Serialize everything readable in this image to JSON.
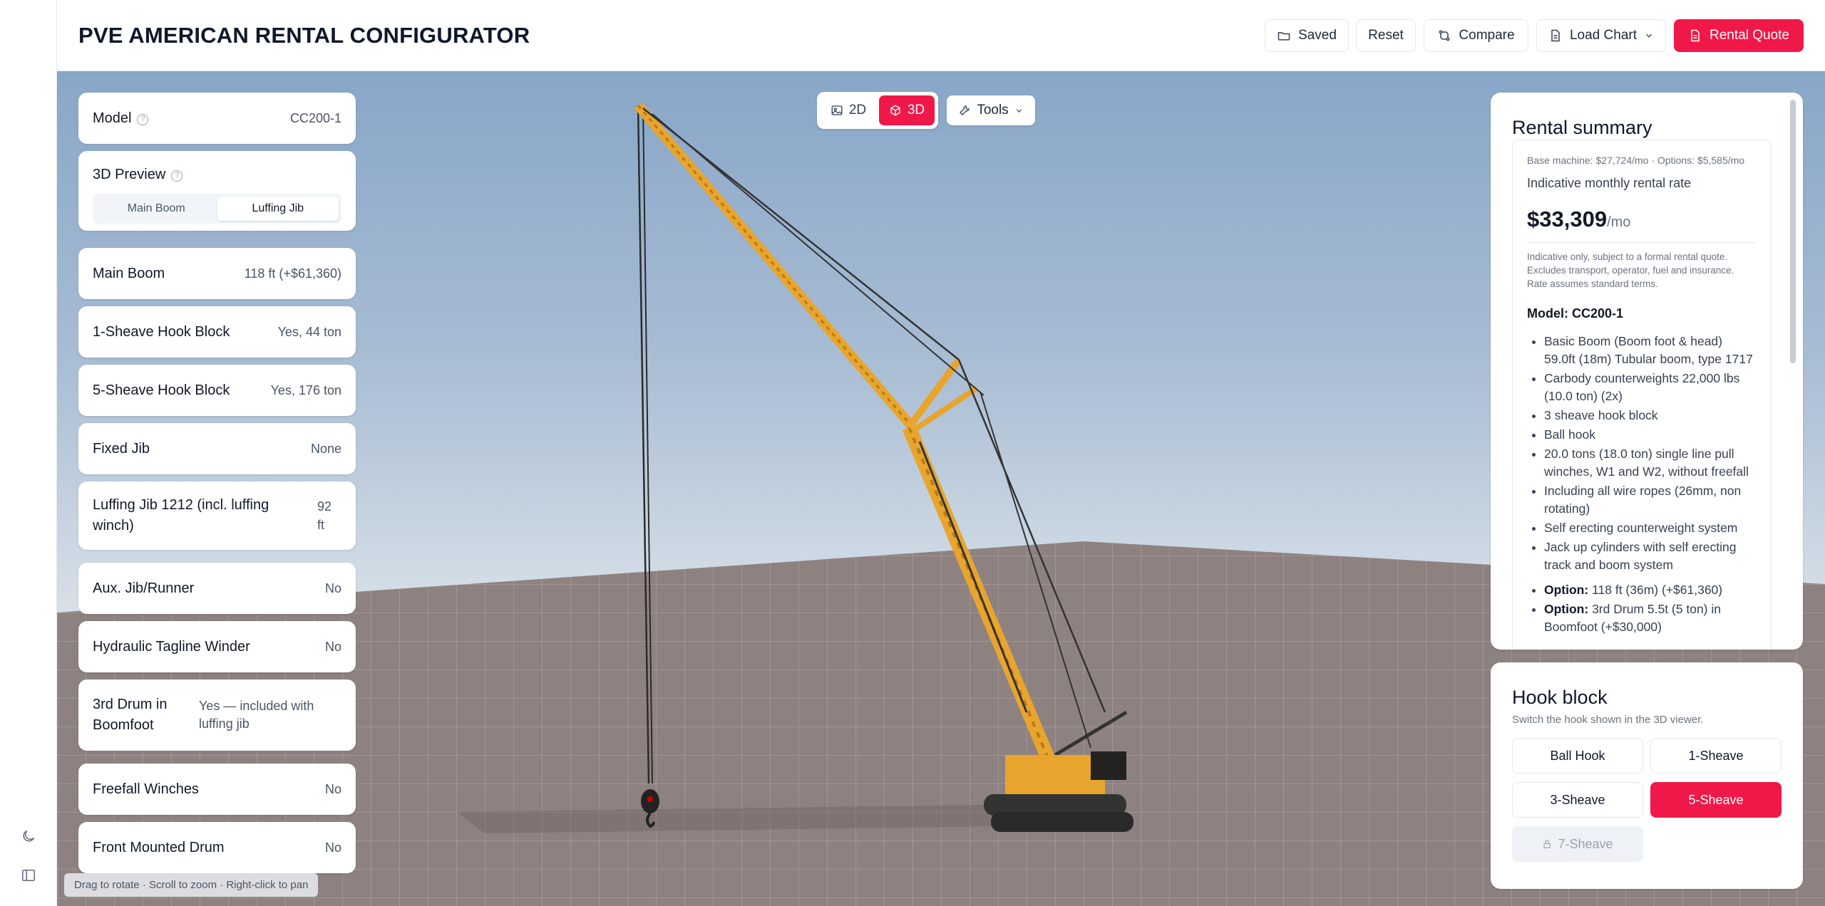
{
  "app": {
    "title": "PVE AMERICAN RENTAL CONFIGURATOR"
  },
  "header": {
    "saved": "Saved",
    "reset": "Reset",
    "compare": "Compare",
    "load_chart": "Load Chart",
    "rental_quote": "Rental Quote"
  },
  "viewer": {
    "mode_2d": "2D",
    "mode_3d": "3D",
    "selected_mode": "3D",
    "tools": "Tools",
    "hint": "Drag to rotate · Scroll to zoom · Right-click to pan"
  },
  "config": {
    "model": {
      "label": "Model",
      "value": "CC200-1"
    },
    "preview": {
      "label": "3D Preview",
      "options": [
        "Main Boom",
        "Luffing Jib"
      ],
      "selected": "Luffing Jib"
    },
    "options": [
      {
        "label": "Main Boom",
        "value": "118 ft (+$61,360)"
      },
      {
        "label": "1-Sheave Hook Block",
        "value": "Yes, 44 ton"
      },
      {
        "label": "5-Sheave Hook Block",
        "value": "Yes, 176 ton"
      },
      {
        "label": "Fixed Jib",
        "value": "None"
      },
      {
        "label": "Luffing Jib 1212 (incl. luffing winch)",
        "value": "92 ft"
      },
      {
        "label": "Aux. Jib/Runner",
        "value": "No"
      },
      {
        "label": "Hydraulic Tagline Winder",
        "value": "No"
      },
      {
        "label": "3rd Drum in Boomfoot",
        "value": "Yes — included with luffing jib"
      },
      {
        "label": "Freefall Winches",
        "value": "No"
      },
      {
        "label": "Front Mounted Drum",
        "value": "No"
      }
    ]
  },
  "summary": {
    "title": "Rental summary",
    "breakdown": "Base machine: $27,724/mo · Options: $5,585/mo",
    "rate_label": "Indicative monthly rental rate",
    "rate": "$33,309",
    "rate_unit": "/mo",
    "disclaimer": "Indicative only, subject to a formal rental quote. Excludes transport, operator, fuel and insurance. Rate assumes standard terms.",
    "model_line": "Model: CC200-1",
    "features": [
      "Basic Boom (Boom foot & head) 59.0ft (18m) Tubular boom, type 1717",
      "Carbody counterweights 22,000 lbs (10.0 ton) (2x)",
      "3 sheave hook block",
      "Ball hook",
      "20.0 tons (18.0 ton) single line pull winches, W1 and W2, without freefall",
      "Including all wire ropes (26mm, non rotating)",
      "Self erecting counterweight system",
      "Jack up cylinders with self erecting track and boom system"
    ],
    "option_prefix": "Option:",
    "options": [
      "118 ft (36m) (+$61,360)",
      "3rd Drum 5.5t (5 ton) in Boomfoot (+$30,000)"
    ]
  },
  "hook_block": {
    "title": "Hook block",
    "subtitle": "Switch the hook shown in the 3D viewer.",
    "buttons": [
      "Ball Hook",
      "1-Sheave",
      "3-Sheave",
      "5-Sheave",
      "7-Sheave"
    ],
    "selected": "5-Sheave",
    "disabled": "7-Sheave"
  },
  "colors": {
    "accent": "#f01848",
    "crane": "#e8a52e",
    "floor": "#8e8280"
  }
}
